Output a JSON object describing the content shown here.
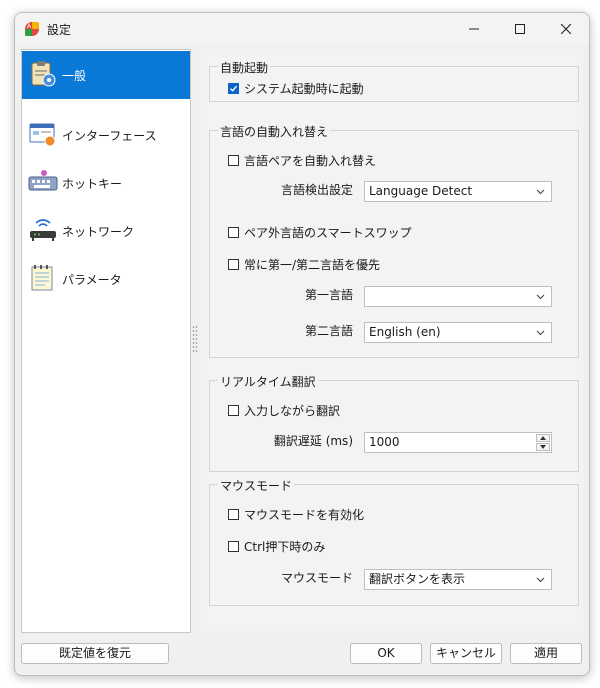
{
  "window": {
    "title": "設定"
  },
  "sidebar": {
    "items": [
      {
        "label": "一般",
        "icon": "clipboard-settings-icon",
        "selected": true
      },
      {
        "label": "インターフェース",
        "icon": "window-interface-icon",
        "selected": false
      },
      {
        "label": "ホットキー",
        "icon": "keyboard-icon",
        "selected": false
      },
      {
        "label": "ネットワーク",
        "icon": "router-icon",
        "selected": false
      },
      {
        "label": "パラメータ",
        "icon": "notepad-icon",
        "selected": false
      }
    ]
  },
  "general": {
    "autostart": {
      "title": "自動起動",
      "startup_label": "システム起動時に起動",
      "startup_checked": true
    },
    "auto_swap": {
      "title": "言語の自動入れ替え",
      "swap_pair_label": "言語ペアを自動入れ替え",
      "swap_pair_checked": false,
      "detect_label": "言語検出設定",
      "detect_value": "Language Detect",
      "smart_swap_label": "ペア外言語のスマートスワップ",
      "smart_swap_checked": false,
      "prefer_label": "常に第一/第二言語を優先",
      "prefer_checked": false,
      "first_lang_label": "第一言語",
      "first_lang_value": "",
      "second_lang_label": "第二言語",
      "second_lang_value": "English (en)"
    },
    "realtime": {
      "title": "リアルタイム翻訳",
      "translate_typing_label": "入力しながら翻訳",
      "translate_typing_checked": false,
      "delay_label": "翻訳遅延 (ms)",
      "delay_value": "1000"
    },
    "mouse": {
      "title": "マウスモード",
      "enable_label": "マウスモードを有効化",
      "enable_checked": false,
      "ctrl_label": "Ctrl押下時のみ",
      "ctrl_checked": false,
      "mode_label": "マウスモード",
      "mode_value": "翻訳ボタンを表示"
    }
  },
  "footer": {
    "reset_label": "既定値を復元",
    "ok_label": "OK",
    "cancel_label": "キャンセル",
    "apply_label": "適用"
  },
  "colors": {
    "accent": "#0a78d7",
    "checkbox_checked": "#0a64c8"
  }
}
